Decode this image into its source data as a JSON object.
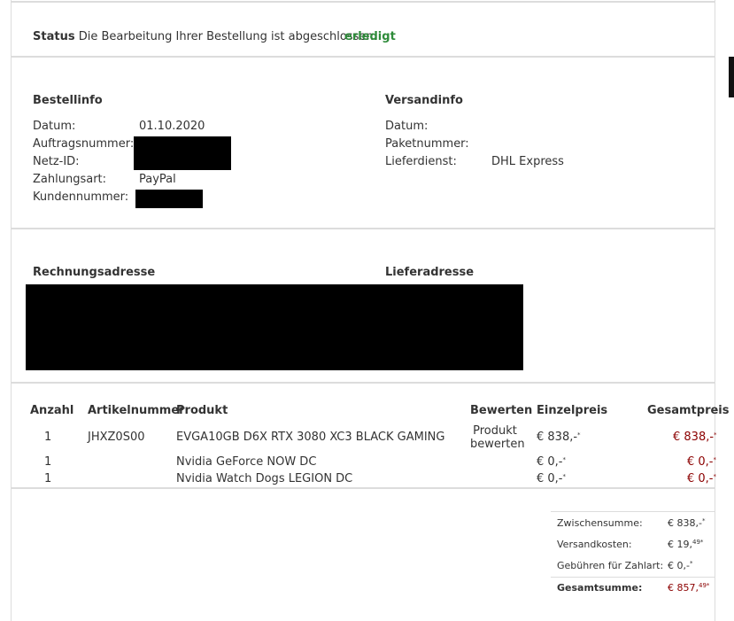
{
  "status": {
    "label": "Status",
    "text": "Die Bearbeitung Ihrer Bestellung ist abgeschlossen.",
    "state": "erledigt"
  },
  "bestellinfo": {
    "heading": "Bestellinfo",
    "datum_label": "Datum:",
    "datum_value": "01.10.2020",
    "auftrag_label": "Auftragsnummer:",
    "netz_label": "Netz-ID:",
    "zahlungsart_label": "Zahlungsart:",
    "zahlungsart_value": "PayPal",
    "kunden_label": "Kundennummer:"
  },
  "versandinfo": {
    "heading": "Versandinfo",
    "datum_label": "Datum:",
    "paket_label": "Paketnummer:",
    "dienst_label": "Lieferdienst:",
    "dienst_value": "DHL Express"
  },
  "addresses": {
    "rechnung_heading": "Rechnungsadresse",
    "liefer_heading": "Lieferadresse"
  },
  "table": {
    "headers": {
      "anzahl": "Anzahl",
      "artikel": "Artikelnummer",
      "produkt": "Produkt",
      "bewerten": "Bewerten",
      "einzel": "Einzelpreis",
      "gesamt": "Gesamtpreis"
    },
    "rows": [
      {
        "qty": "1",
        "sku": "JHXZ0S00",
        "product": "EVGA10GB D6X RTX 3080 XC3 BLACK GAMING",
        "rate_line1": "Produkt",
        "rate_line2": "bewerten",
        "unit_price": "€ 838,-",
        "total": "€ 838,-"
      },
      {
        "qty": "1",
        "sku": "",
        "product": "Nvidia GeForce NOW DC",
        "rate_line1": "",
        "rate_line2": "",
        "unit_price": "€ 0,-",
        "total": "€ 0,-"
      },
      {
        "qty": "1",
        "sku": "",
        "product": "Nvidia Watch Dogs LEGION DC",
        "rate_line1": "",
        "rate_line2": "",
        "unit_price": "€ 0,-",
        "total": "€ 0,-"
      }
    ]
  },
  "summary": {
    "zwischen_label": "Zwischensumme:",
    "zwischen_value": "€ 838,-",
    "versand_label": "Versandkosten:",
    "versand_main": "€ 19,",
    "versand_cents": "49",
    "gebuehren_label": "Gebühren für Zahlart:",
    "gebuehren_value": "€ 0,-",
    "gesamt_label": "Gesamtsumme:",
    "gesamt_main": "€ 857,",
    "gesamt_cents": "49"
  },
  "colors": {
    "accent_green": "#2e8b3a",
    "price_red": "#8b0000",
    "divider": "#dcdcdc"
  }
}
